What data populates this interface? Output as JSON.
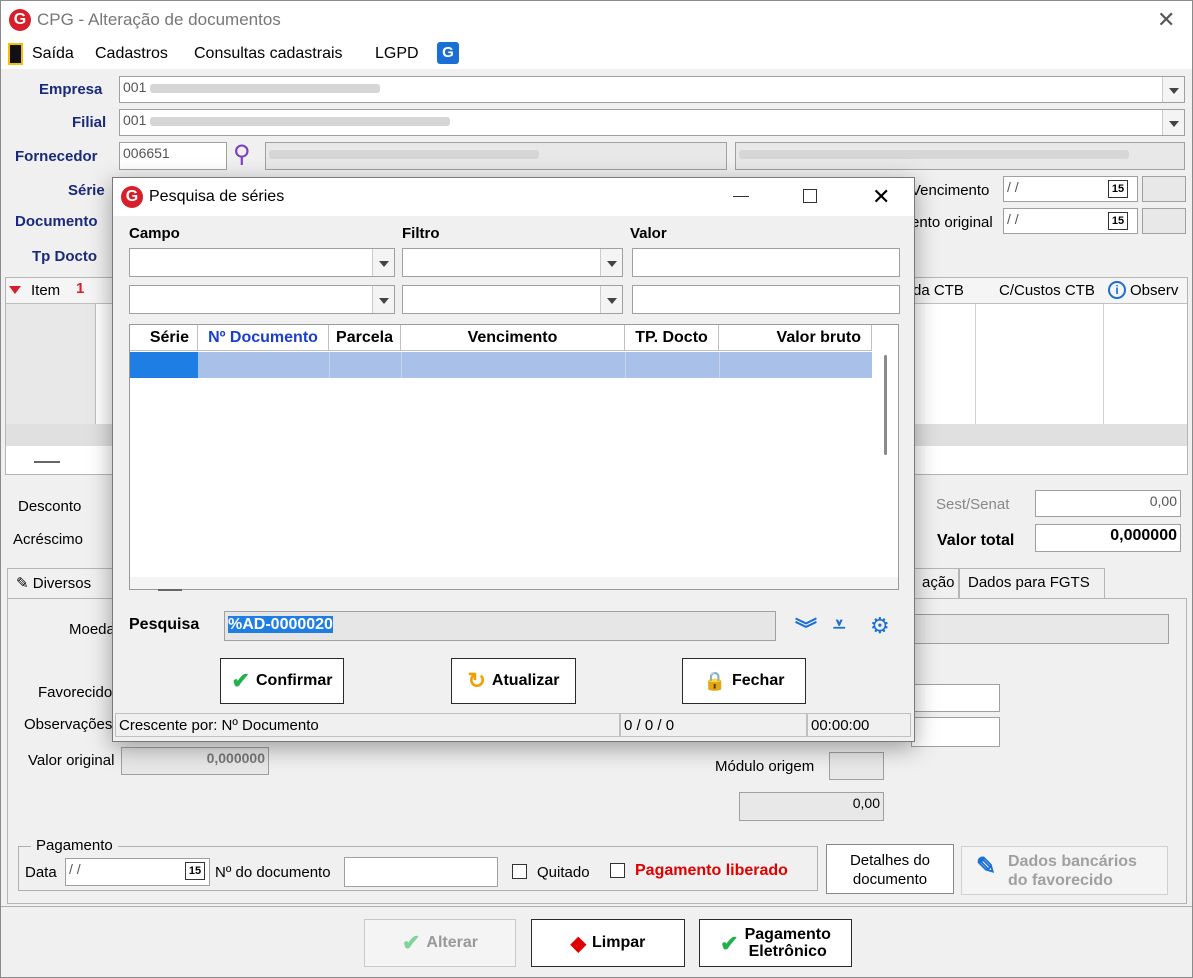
{
  "window": {
    "title": "CPG - Alteração de documentos"
  },
  "menu": [
    "Saída",
    "Cadastros",
    "Consultas cadastrais",
    "LGPD"
  ],
  "form": {
    "empresa_label": "Empresa",
    "empresa_value": "001",
    "filial_label": "Filial",
    "filial_value": "001",
    "fornecedor_label": "Fornecedor",
    "fornecedor_value": "006651",
    "serie_label": "Série",
    "documento_label": "Documento",
    "tpdocto_label": "Tp Docto",
    "vencimento_label": "Vencimento",
    "vencimento_original_label": "ento original",
    "date_placeholder": " / /",
    "desconto_label": "Desconto",
    "acrescimo_label": "Acréscimo",
    "sestsenat_label": "Sest/Senat",
    "sestsenat_value": "0,00",
    "valortotal_label": "Valor total",
    "valortotal_value": "0,000000",
    "moeda_label": "Moeda",
    "favorecido_label": "Favorecido",
    "observacoes_label": "Observações",
    "valororiginal_label": "Valor original",
    "valororiginal_value": "0,000000",
    "modulo_label": "Módulo origem",
    "misc_value": "0,00"
  },
  "grid": {
    "item_label": "Item",
    "item_sort": "1",
    "ctb_label": "da CTB",
    "ccusto_label": "C/Custos CTB",
    "observ_label": "Observ"
  },
  "tabs": [
    "Diversos",
    "ação",
    "Dados para FGTS"
  ],
  "pagamento": {
    "legend": "Pagamento",
    "data_label": "Data",
    "data_value": " / /",
    "ndoc_label": "Nº do documento",
    "quitado_label": "Quitado",
    "liberado_label": "Pagamento liberado",
    "detalhes_label_1": "Detalhes do",
    "detalhes_label_2": "documento",
    "dados_label_1": "Dados bancários",
    "dados_label_2": "do favorecido"
  },
  "bottom_buttons": {
    "alterar": "Alterar",
    "limpar": "Limpar",
    "pagamento_1": "Pagamento",
    "pagamento_2": "Eletrônico"
  },
  "dialog": {
    "title": "Pesquisa de séries",
    "campo_label": "Campo",
    "filtro_label": "Filtro",
    "valor_label": "Valor",
    "columns": [
      "Série",
      "Nº Documento",
      "Parcela",
      "Vencimento",
      "TP. Docto",
      "Valor bruto"
    ],
    "pesquisa_label": "Pesquisa",
    "pesquisa_value": "%AD-0000020",
    "confirmar": "Confirmar",
    "atualizar": "Atualizar",
    "fechar": "Fechar",
    "status_order": "Crescente por: Nº Documento",
    "status_counts": "0 / 0 / 0",
    "status_time": "00:00:00"
  },
  "colors": {
    "accent_blue": "#1a6fd6",
    "brand_red": "#d81e2a",
    "label_blue": "#1a2a7a",
    "selection": "#a9c1e8",
    "warn_red": "#e00000"
  }
}
